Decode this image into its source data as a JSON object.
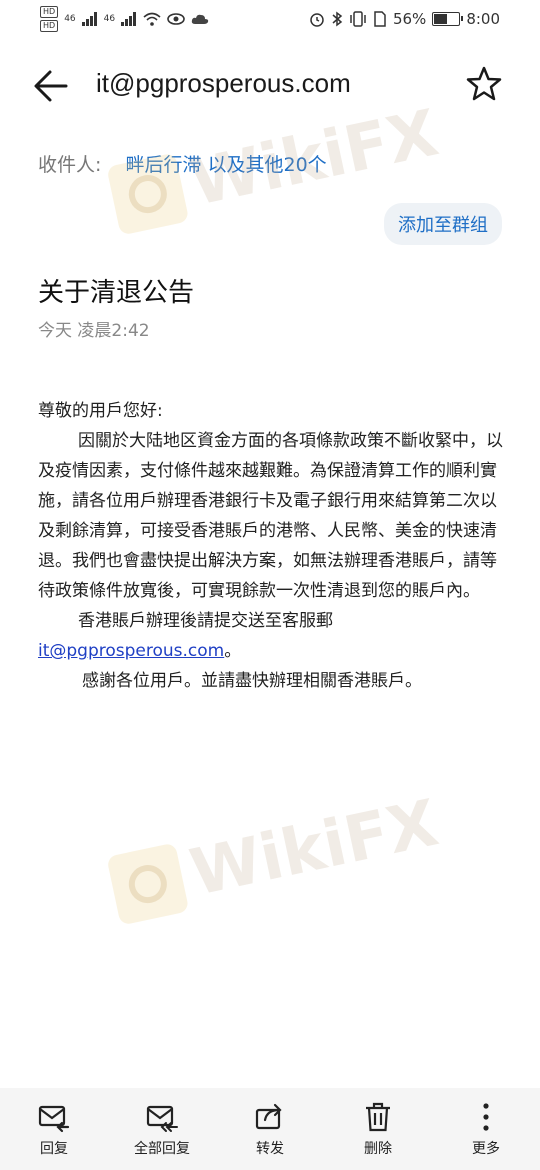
{
  "status_bar": {
    "net1": "HD",
    "net2": "HD",
    "sig1": "46",
    "sig2": "46",
    "battery": "56%",
    "time": "8:00"
  },
  "header": {
    "title": "it@pgprosperous.com"
  },
  "recipients": {
    "label": "收件人:",
    "value": "畔后行滞 以及其他20个"
  },
  "add_group_label": "添加至群组",
  "email": {
    "subject": "关于清退公告",
    "time": "今天 凌晨2:42",
    "greeting": "尊敬的用戶您好:",
    "paragraph1": "因關於大陆地区資金方面的各項條款政策不斷收緊中，以及疫情因素，支付條件越來越艱難。為保證清算工作的順利實施，請各位用戶辦理香港銀行卡及電子銀行用來結算第二次以及剩餘清算，可接受香港賬戶的港幣、人民幣、美金的快速清退。我們也會盡快提出解決方案，如無法辦理香港賬戶，請等待政策條件放寬後，可實現餘款一次性清退到您的賬戶內。",
    "paragraph2": "香港賬戶辦理後請提交送至客服郵",
    "email_link": "it@pgprosperous.com",
    "link_suffix": "。",
    "paragraph3": "感謝各位用戶。並請盡快辦理相關香港賬戶。"
  },
  "watermark_text": "WikiFX",
  "toolbar": {
    "reply": "回复",
    "reply_all": "全部回复",
    "forward": "转发",
    "delete": "删除",
    "more": "更多"
  }
}
